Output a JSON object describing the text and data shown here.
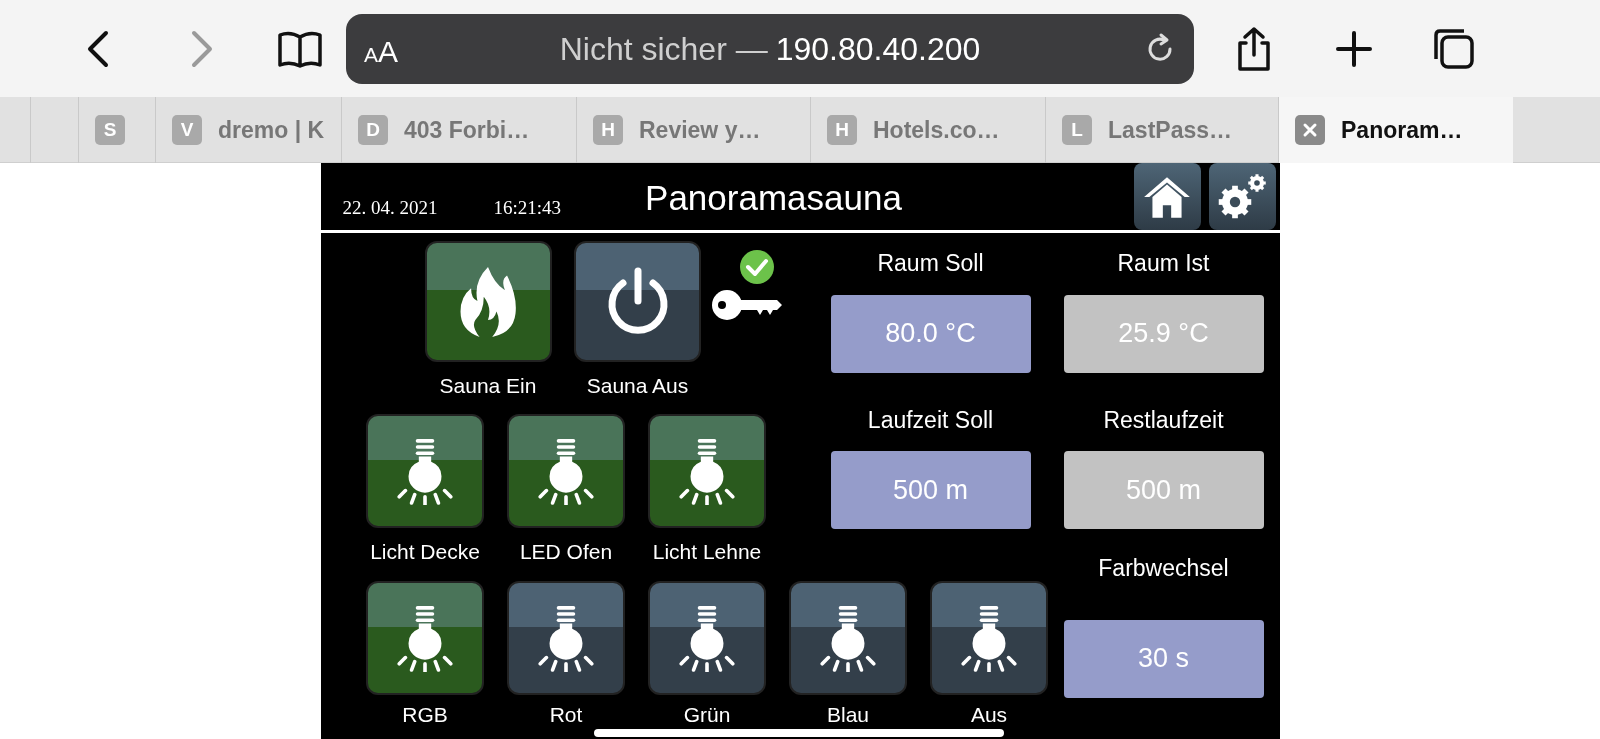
{
  "browser": {
    "text_size_label": "AA",
    "address": {
      "security": "Nicht sicher —",
      "host": "190.80.40.200"
    },
    "forward_disabled": true
  },
  "tabs": [
    {
      "favicon": "S",
      "selected": false
    },
    {
      "favicon": "V",
      "title": "dremo | K",
      "selected": false
    },
    {
      "favicon": "D",
      "title": "403 Forbi…",
      "selected": false
    },
    {
      "favicon": "H",
      "title": "Review y…",
      "selected": false
    },
    {
      "favicon": "H",
      "title": "Hotels.co…",
      "selected": false
    },
    {
      "favicon": "L",
      "title": "LastPass…",
      "selected": false
    },
    {
      "title": "Panoram…",
      "selected": true
    }
  ],
  "panel": {
    "date": "22. 04. 2021",
    "time": "16:21:43",
    "title": "Panoramasauna",
    "sauna_buttons": [
      {
        "kind": "flame",
        "label": "Sauna Ein",
        "on": true
      },
      {
        "kind": "power",
        "label": "Sauna Aus",
        "on": false
      }
    ],
    "key_status": {
      "unlocked": true
    },
    "light_rows": [
      [
        {
          "label": "Licht Decke",
          "on": true
        },
        {
          "label": "LED Ofen",
          "on": true
        },
        {
          "label": "Licht Lehne",
          "on": true
        }
      ],
      [
        {
          "label": "RGB",
          "on": true
        },
        {
          "label": "Rot",
          "on": false
        },
        {
          "label": "Grün",
          "on": false
        },
        {
          "label": "Blau",
          "on": false
        },
        {
          "label": "Aus",
          "on": false
        }
      ]
    ],
    "values": [
      {
        "label": "Raum Soll",
        "value": "80.0 °C",
        "kind": "setpoint"
      },
      {
        "label": "Raum Ist",
        "value": "25.9 °C",
        "kind": "actual"
      },
      {
        "label": "Laufzeit Soll",
        "value": "500 m",
        "kind": "setpoint"
      },
      {
        "label": "Restlaufzeit",
        "value": "500 m",
        "kind": "actual"
      },
      {
        "label": "Farbwechsel",
        "value": "30 s",
        "kind": "setpoint"
      }
    ]
  }
}
